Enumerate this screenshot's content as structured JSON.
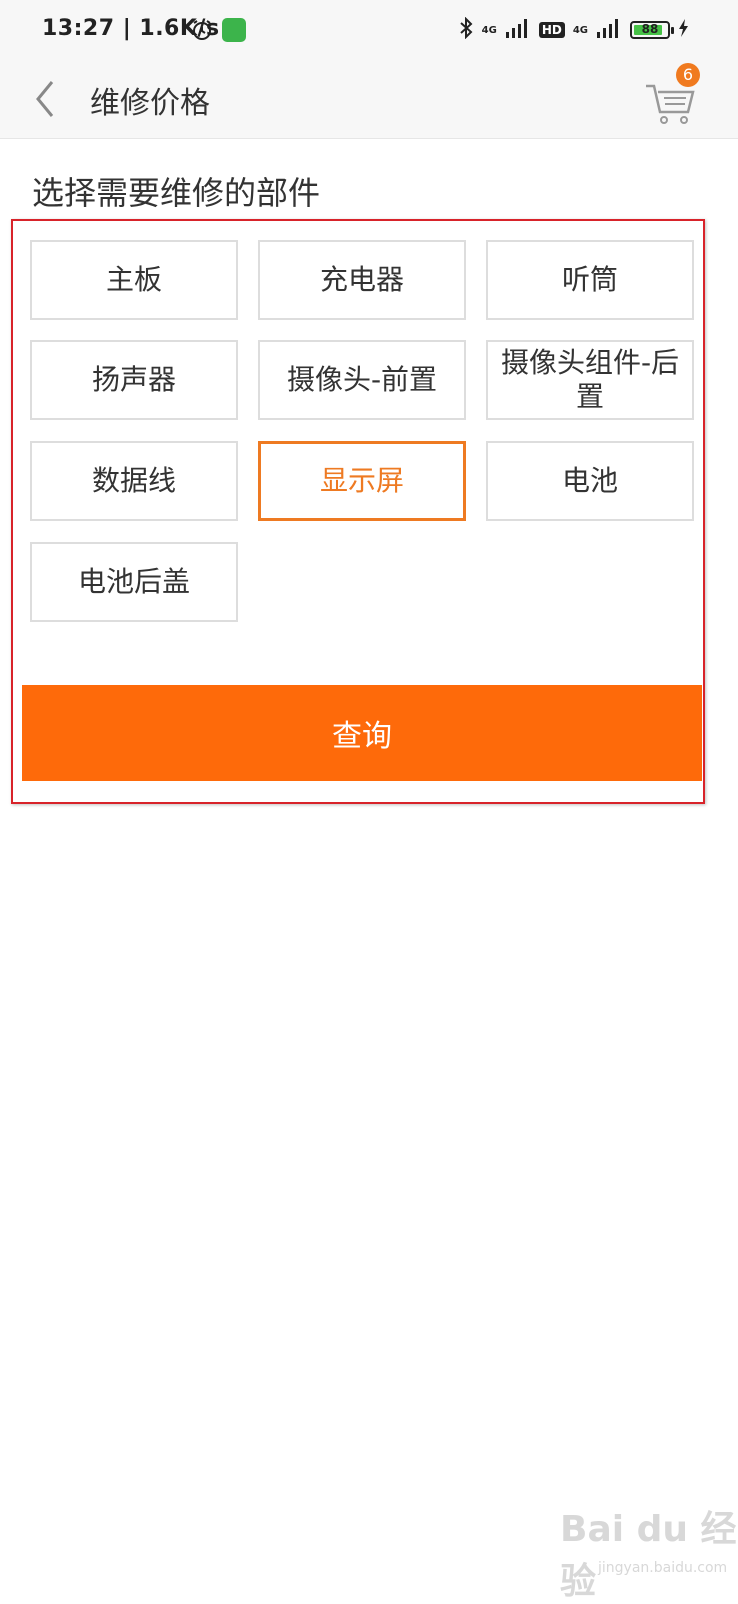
{
  "status_bar": {
    "time": "13:27 | 1.6K/s",
    "network_1": "4G",
    "network_2": "4G",
    "hd": "HD",
    "battery": "88",
    "icons": [
      "alarm-icon",
      "app-notification-icon",
      "bluetooth-icon",
      "signal-icon",
      "battery-icon",
      "charging-icon"
    ]
  },
  "navbar": {
    "title": "维修价格",
    "back_icon": "chevron-left-icon",
    "cart_icon": "shopping-cart-icon",
    "cart_badge": "6"
  },
  "section_title": "选择需要维修的部件",
  "parts": [
    {
      "label": "主板",
      "selected": false
    },
    {
      "label": "充电器",
      "selected": false
    },
    {
      "label": "听筒",
      "selected": false
    },
    {
      "label": "扬声器",
      "selected": false
    },
    {
      "label": "摄像头-前置",
      "selected": false
    },
    {
      "label": "摄像头组件-后置",
      "selected": false
    },
    {
      "label": "数据线",
      "selected": false
    },
    {
      "label": "显示屏",
      "selected": true
    },
    {
      "label": "电池",
      "selected": false
    },
    {
      "label": "电池后盖",
      "selected": false
    }
  ],
  "query_button": "查询",
  "colors": {
    "accent": "#fe6a0a",
    "selected_border": "#ee7a22",
    "highlight_border": "#d8232a",
    "badge": "#f07a1f",
    "battery_fill": "#47c247",
    "app_icon": "#3cb44b"
  },
  "watermark": {
    "text": "Bai du 经验",
    "sub": "jingyan.baidu.com"
  }
}
